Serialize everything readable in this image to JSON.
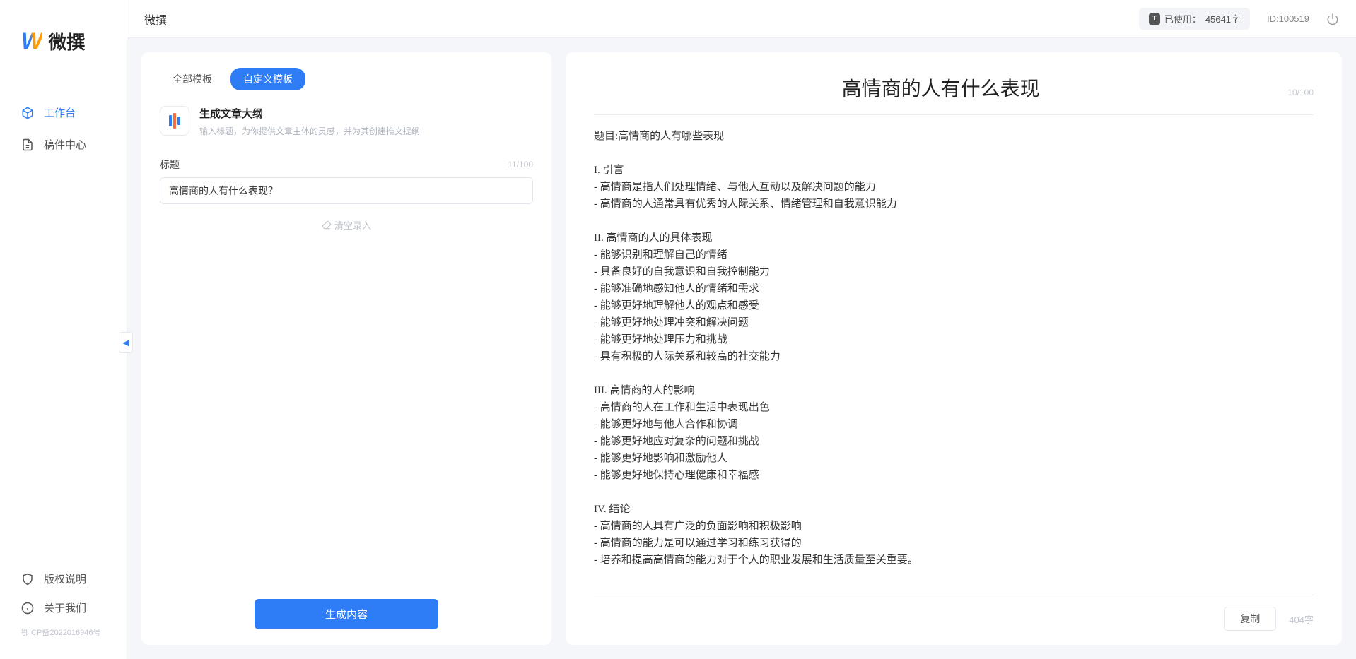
{
  "brand": {
    "logo_letter": "W",
    "name": "微撰"
  },
  "nav": {
    "workspace": "工作台",
    "drafts": "稿件中心",
    "copyright": "版权说明",
    "about": "关于我们",
    "icp": "鄂ICP备2022016946号"
  },
  "topbar": {
    "breadcrumb": "微撰",
    "usage_label": "已使用：",
    "usage_value": "45641字",
    "id_label": "ID:",
    "id_value": "100519"
  },
  "tabs": {
    "all": "全部模板",
    "custom": "自定义模板"
  },
  "template": {
    "title": "生成文章大纲",
    "desc": "输入标题，为你提供文章主体的灵感，并为其创建推文提纲"
  },
  "form": {
    "label": "标题",
    "char_count": "11/100",
    "value": "高情商的人有什么表现？",
    "clear": "清空录入",
    "submit": "生成内容"
  },
  "output": {
    "title": "高情商的人有什么表现",
    "title_count": "10/100",
    "body": "题目:高情商的人有哪些表现\n\nI. 引言\n- 高情商是指人们处理情绪、与他人互动以及解决问题的能力\n- 高情商的人通常具有优秀的人际关系、情绪管理和自我意识能力\n\nII. 高情商的人的具体表现\n- 能够识别和理解自己的情绪\n- 具备良好的自我意识和自我控制能力\n- 能够准确地感知他人的情绪和需求\n- 能够更好地理解他人的观点和感受\n- 能够更好地处理冲突和解决问题\n- 能够更好地处理压力和挑战\n- 具有积极的人际关系和较高的社交能力\n\nIII. 高情商的人的影响\n- 高情商的人在工作和生活中表现出色\n- 能够更好地与他人合作和协调\n- 能够更好地应对复杂的问题和挑战\n- 能够更好地影响和激励他人\n- 能够更好地保持心理健康和幸福感\n\nIV. 结论\n- 高情商的人具有广泛的负面影响和积极影响\n- 高情商的能力是可以通过学习和练习获得的\n- 培养和提高高情商的能力对于个人的职业发展和生活质量至关重要。",
    "copy": "复制",
    "word_count": "404字"
  }
}
